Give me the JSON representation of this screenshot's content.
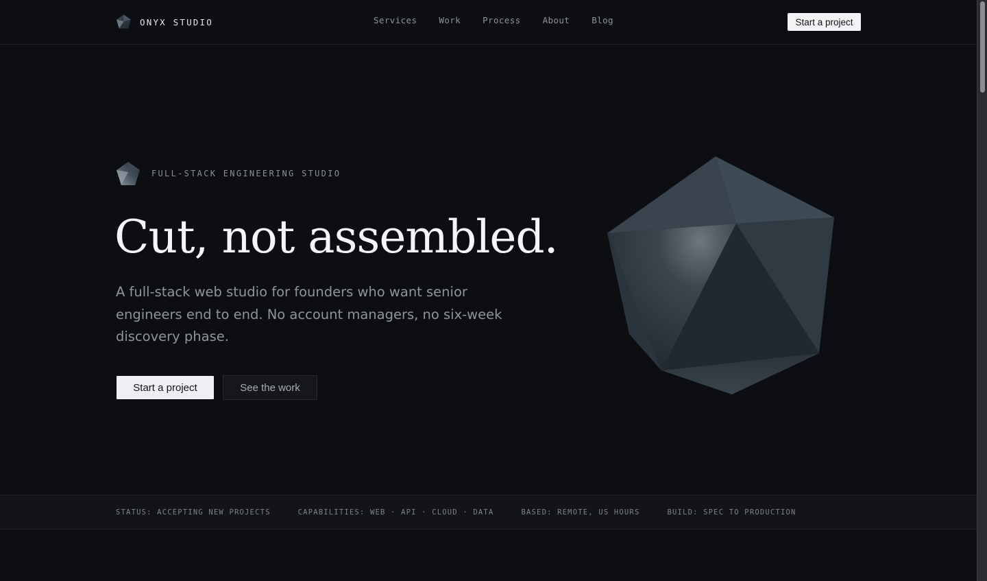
{
  "header": {
    "brand": "ONYX STUDIO",
    "nav": [
      "Services",
      "Work",
      "Process",
      "About",
      "Blog"
    ],
    "cta": "Start a project"
  },
  "hero": {
    "eyebrow": "FULL-STACK ENGINEERING STUDIO",
    "title": "Cut, not assembled.",
    "subtitle": "A full-stack web studio for founders who want senior engineers end to end. No account managers, no six-week discovery phase.",
    "primary_cta": "Start a project",
    "secondary_cta": "See the work"
  },
  "status_strip": [
    "STATUS: ACCEPTING NEW PROJECTS",
    "CAPABILITIES: WEB · API · CLOUD · DATA",
    "BASED: REMOTE, US HOURS",
    "BUILD: SPEC TO PRODUCTION"
  ],
  "icons": {
    "brand_logo": "pentagon-gem-icon",
    "eyebrow_logo": "pentagon-gem-icon",
    "hero_art": "faceted-gem-illustration"
  },
  "colors": {
    "background": "#0d0e11",
    "gem": "#2c3640",
    "primary_button": "#eef0f3"
  }
}
